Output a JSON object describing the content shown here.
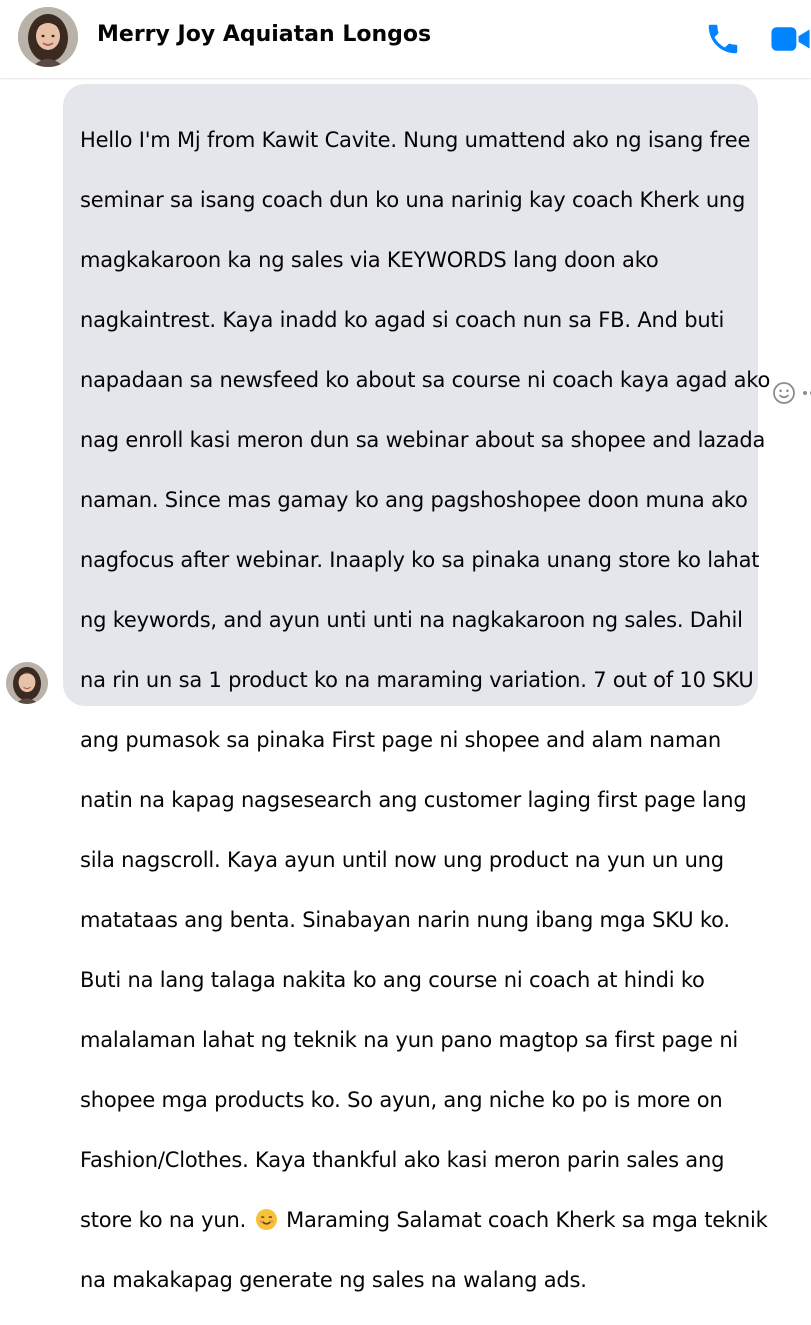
{
  "header": {
    "contact_name": "Merry Joy Aquiatan Longos",
    "avatar_icon": "profile-photo",
    "call_icon": "phone-icon",
    "video_icon": "video-camera-icon"
  },
  "message": {
    "lines": [
      "Hello I'm Mj from Kawit Cavite. Nung umattend ako ng isang free",
      "seminar sa isang coach dun ko una narinig kay coach Kherk ung",
      "magkakaroon ka ng sales via KEYWORDS lang doon ako",
      "nagkaintrest. Kaya inadd ko agad si coach nun sa FB. And buti",
      "napadaan sa newsfeed ko about sa course ni coach kaya agad ako",
      "nag enroll kasi meron dun sa webinar about sa shopee and lazada",
      "naman. Since mas gamay ko ang pagshoshopee doon muna ako",
      "nagfocus after webinar. Inaaply ko sa pinaka unang store ko lahat",
      "ng keywords, and ayun unti unti na nagkakaroon ng sales. Dahil",
      "na rin un sa 1 product ko na maraming variation. 7 out of 10 SKU",
      "ang pumasok sa pinaka First page ni shopee and alam naman",
      "natin na kapag nagsesearch ang customer laging first page lang",
      "sila nagscroll. Kaya ayun until now ung product na yun un ung",
      "matataas ang benta. Sinabayan narin nung ibang mga SKU ko.",
      "Buti na lang talaga nakita ko ang course ni coach at hindi ko",
      "malalaman lahat ng teknik na yun pano magtop sa first page ni",
      "shopee mga products ko. So ayun, ang niche ko po is more on",
      "Fashion/Clothes. Kaya thankful ako kasi meron parin sales ang"
    ],
    "line_with_emoji_before": "store ko na yun.",
    "line_with_emoji_after": "Maraming Salamat coach Kherk sa mga teknik",
    "emoji_icon": "smiling-face-emoji",
    "last_line": "na makakapag generate ng sales na walang ads."
  },
  "actions": {
    "react_icon": "smiley-reaction-icon",
    "more_icon": "more-options-icon"
  },
  "colors": {
    "accent": "#0084ff",
    "bubble": "#e4e6eb",
    "text": "#050505"
  }
}
